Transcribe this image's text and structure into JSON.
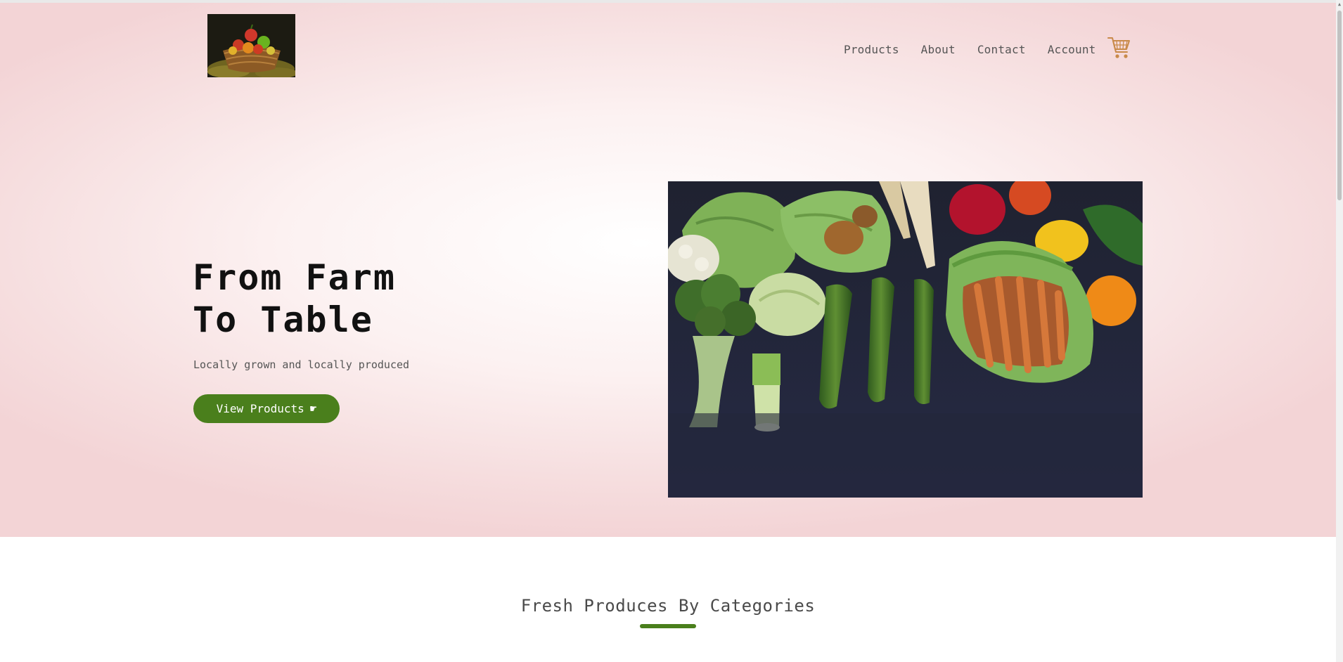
{
  "header": {
    "logo_alt": "Basket of fresh vegetables",
    "nav": {
      "products": "Products",
      "about": "About",
      "contact": "Contact",
      "account": "Account"
    },
    "cart_icon": "shopping-cart-icon"
  },
  "hero": {
    "headline_line1": "From Farm",
    "headline_line2": "To Table",
    "subtitle": "Locally grown and locally produced",
    "cta_label": "View Products",
    "cta_icon": "☛",
    "image_alt": "Fresh vegetables in mesh bags on a dark surface"
  },
  "categories": {
    "title": "Fresh Produces By Categories"
  },
  "colors": {
    "accent": "#4a7f1c",
    "cart": "#c98a4a",
    "hero_bg": "#f6dedf"
  }
}
